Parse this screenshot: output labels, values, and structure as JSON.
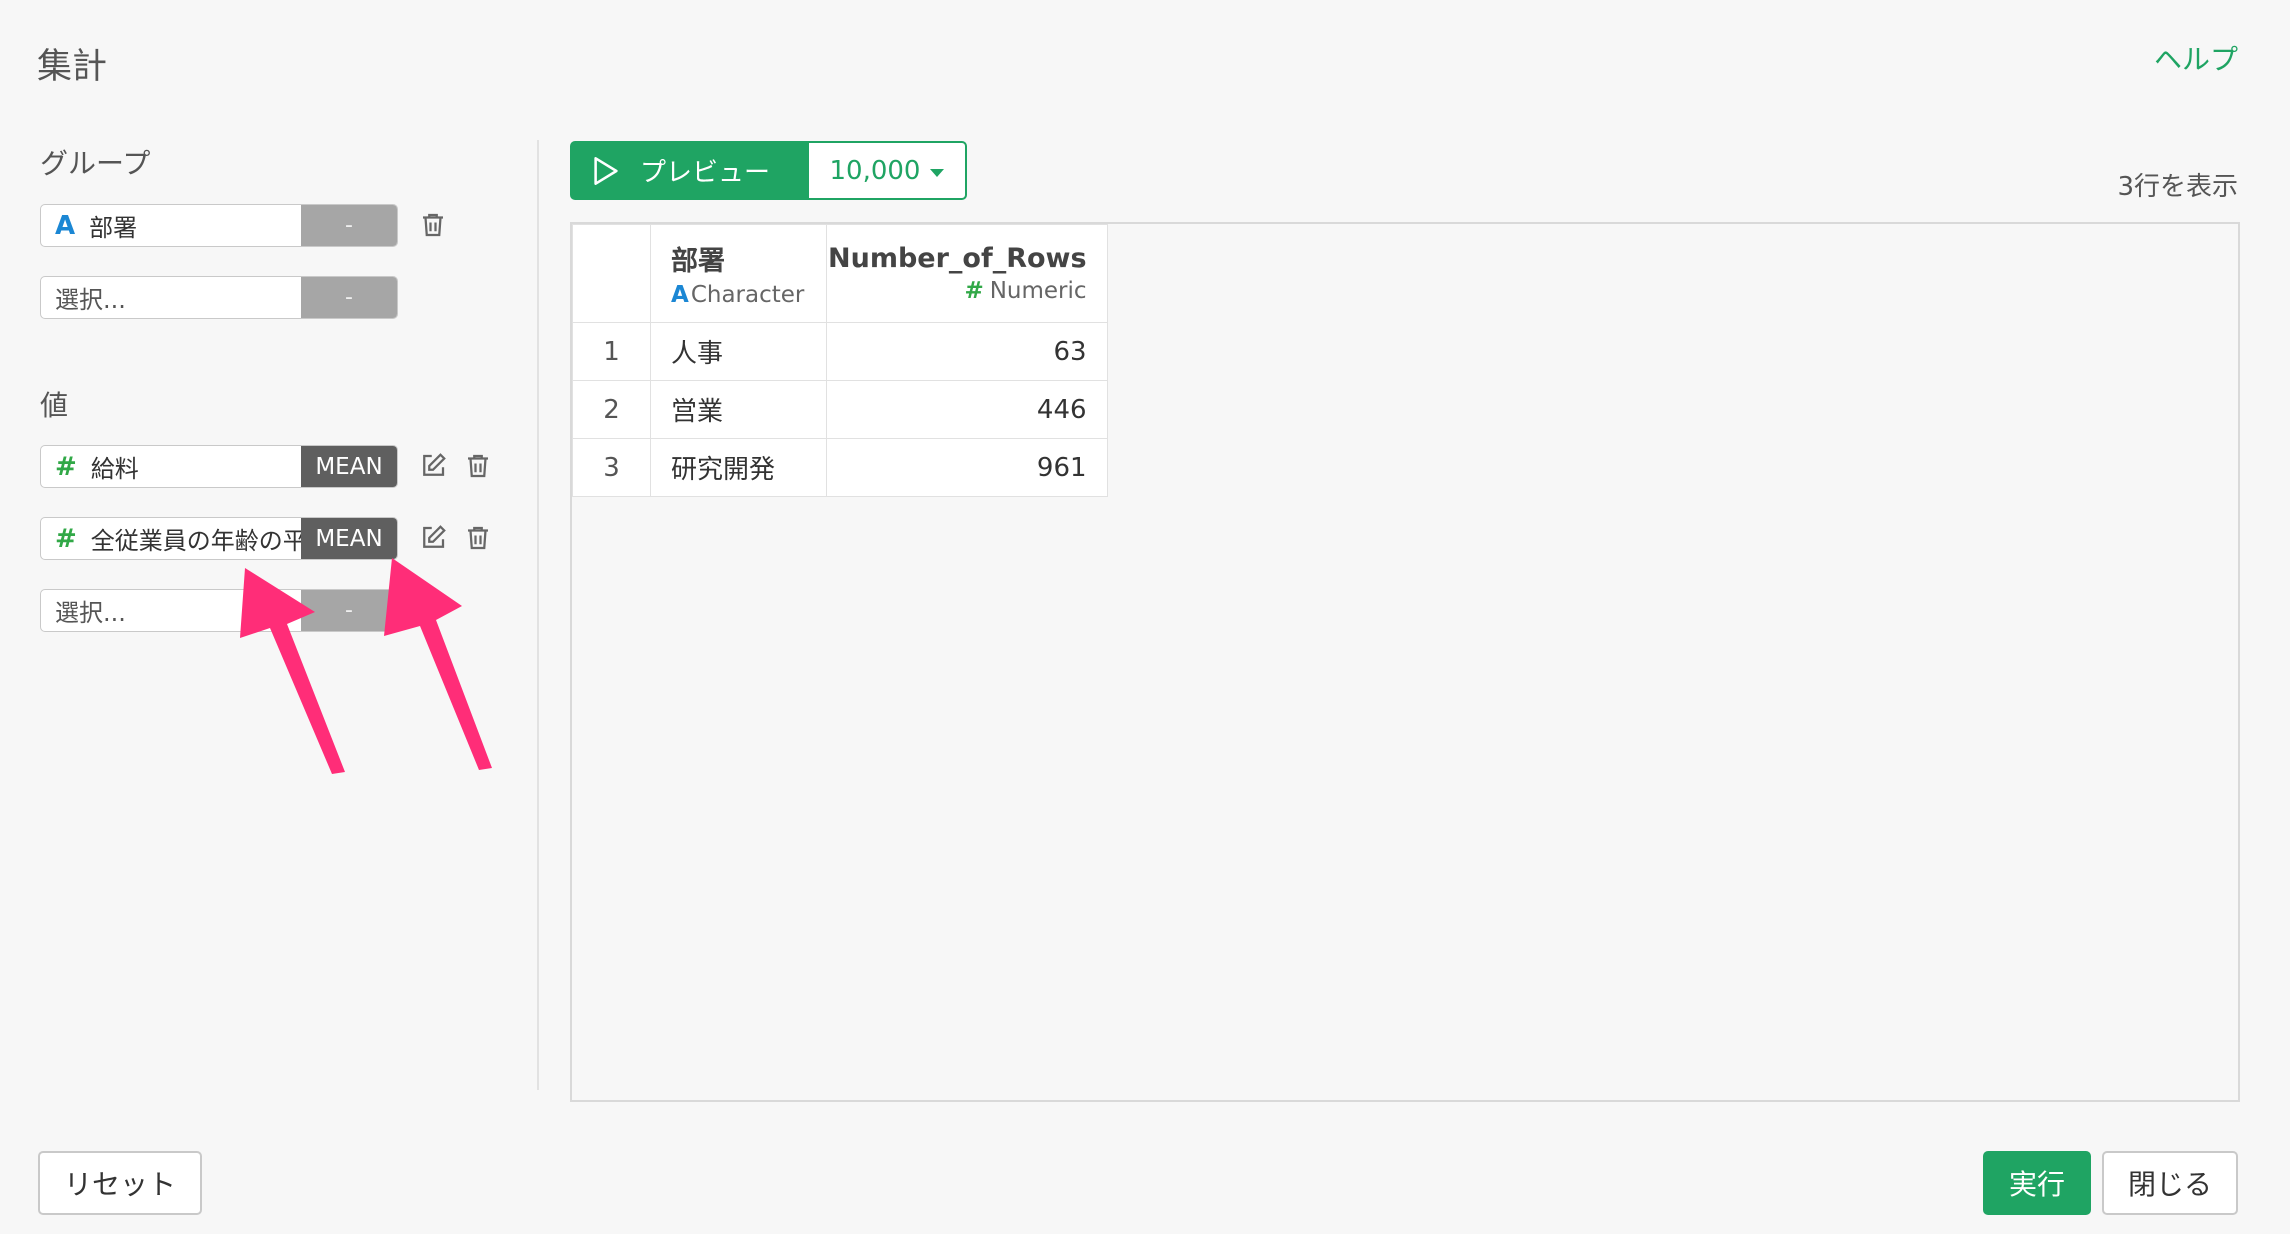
{
  "header": {
    "title": "集計",
    "help_label": "ヘルプ"
  },
  "group_section": {
    "label": "グループ",
    "items": [
      {
        "type_icon": "A",
        "name": "部署",
        "agg": "-"
      }
    ],
    "select_placeholder": "選択...",
    "select_agg": "-"
  },
  "value_section": {
    "label": "値",
    "items": [
      {
        "type_icon": "#",
        "name": "給料",
        "agg": "MEAN"
      },
      {
        "type_icon": "#",
        "name": "全従業員の年齢の平",
        "agg": "MEAN"
      }
    ],
    "select_placeholder": "選択...",
    "select_agg": "-"
  },
  "preview": {
    "button_label": "プレビュー",
    "rows_value": "10,000",
    "row_count_text": "3行を表示"
  },
  "table": {
    "columns": [
      {
        "name": "部署",
        "type_icon": "A",
        "type_label": "Character"
      },
      {
        "name": "Number_of_Rows",
        "type_icon": "#",
        "type_label": "Numeric"
      }
    ],
    "rows": [
      {
        "index": "1",
        "dept": "人事",
        "count": "63"
      },
      {
        "index": "2",
        "dept": "営業",
        "count": "446"
      },
      {
        "index": "3",
        "dept": "研究開発",
        "count": "961"
      }
    ]
  },
  "footer": {
    "reset_label": "リセット",
    "run_label": "実行",
    "close_label": "閉じる"
  },
  "colors": {
    "accent": "#1fa463",
    "annotation_arrow": "#ff2d78",
    "character_type": "#1b87d4",
    "numeric_type": "#31a847"
  }
}
